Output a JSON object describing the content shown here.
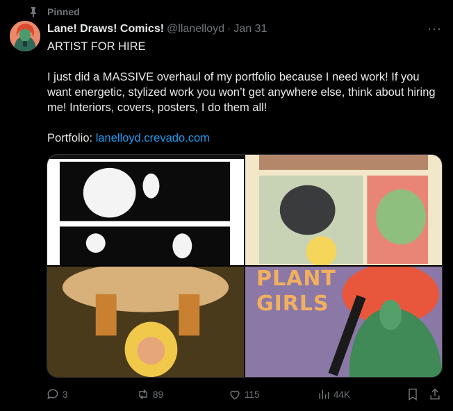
{
  "pinned_label": "Pinned",
  "post": {
    "display_name": "Lane! Draws! Comics!",
    "handle": "@llanelloyd",
    "separator": "·",
    "date": "Jan 31",
    "more_label": "···",
    "lines": {
      "title": "ARTIST FOR HIRE",
      "paragraph": "I just did a MASSIVE overhaul of my portfolio because I need work! If you want energetic, stylized work you won’t get anywhere else, think about hiring me! Interiors, covers, posters, I do them all!",
      "portfolio_label": "Portfolio: ",
      "portfolio_link": "lanelloyd.crevado.com"
    },
    "media": {
      "tiles": [
        {
          "description": "black and white comic page"
        },
        {
          "description": "color comic panels"
        },
        {
          "description": "character lifting rock"
        },
        {
          "text": "PLANT GIRLS"
        }
      ]
    },
    "actions": {
      "replies": "3",
      "reposts": "89",
      "likes": "115",
      "views": "44K"
    }
  },
  "icons": [
    "pin-icon",
    "reply-icon",
    "repost-icon",
    "like-icon",
    "views-icon",
    "bookmark-icon",
    "share-icon",
    "more-icon"
  ],
  "colors": {
    "background": "#000000",
    "text": "#e7e9ea",
    "muted": "#71767b",
    "link": "#1d9bf0"
  }
}
